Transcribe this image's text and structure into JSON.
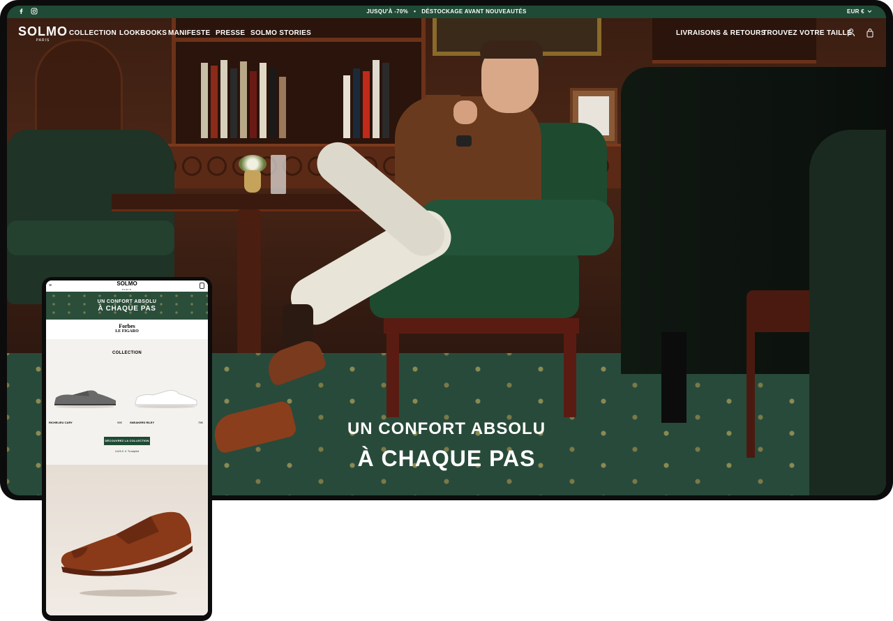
{
  "announcement": {
    "left_text": "JUSQU'À -70%",
    "separator": "•",
    "right_text": "DÉSTOCKAGE AVANT NOUVEAUTÉS",
    "currency": "EUR €"
  },
  "brand": {
    "name": "SOLMO",
    "city": "PARIS"
  },
  "nav": {
    "left": [
      "COLLECTION",
      "LOOKBOOKS",
      "MANIFESTE",
      "PRESSE",
      "SOLMO STORIES"
    ],
    "right": [
      "LIVRAISONS & RETOURS",
      "TROUVEZ VOTRE TAILLE"
    ]
  },
  "hero": {
    "line1": "UN CONFORT ABSOLU",
    "line2": "À CHAQUE PAS"
  },
  "mobile": {
    "brand": "SOLMO",
    "city": "PARIS",
    "banner_line1": "UN CONFORT ABSOLU",
    "banner_line2": "À CHAQUE PAS",
    "press_line1": "Forbes",
    "press_line2": "LE FIGARO",
    "section_title": "COLLECTION",
    "products": [
      {
        "name": "RICHELIEU CARY",
        "price": "95€"
      },
      {
        "name": "SNEAKERS RILEY",
        "price": "75€"
      }
    ],
    "cta": "DÉCOUVREZ LA COLLECTION",
    "rating": "4.6/5.0",
    "rating_provider": "Trustpilot"
  },
  "colors": {
    "brand_green": "#1f4a35",
    "white": "#ffffff"
  },
  "icons": [
    "facebook-icon",
    "instagram-icon",
    "chevron-down-icon",
    "account-icon",
    "bag-icon",
    "menu-icon"
  ]
}
